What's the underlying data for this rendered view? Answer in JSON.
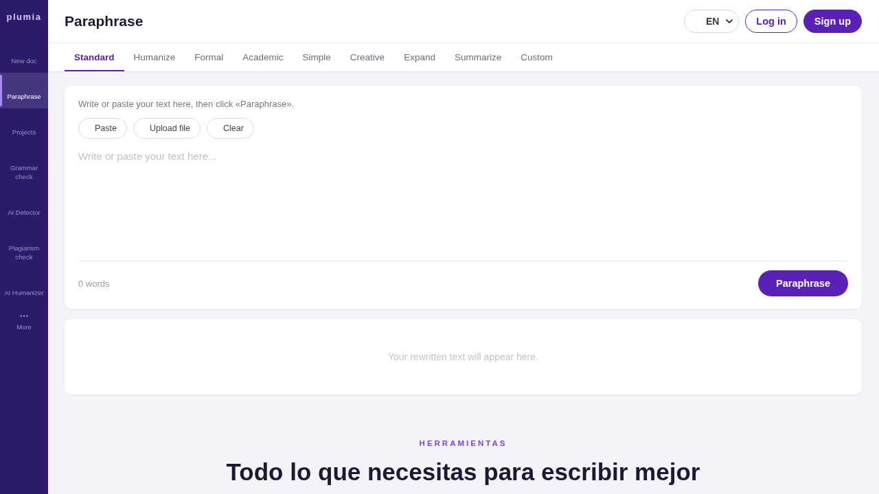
{
  "sidebar": {
    "logo": "plumia",
    "items": [
      {
        "label": "New doc",
        "selected": false
      },
      {
        "label": "Paraphrase",
        "selected": true
      },
      {
        "label": "Projects",
        "selected": false
      },
      {
        "label": "Grammar check",
        "selected": false
      },
      {
        "label": "AI Detector",
        "selected": false
      },
      {
        "label": "Plagiarism check",
        "selected": false
      },
      {
        "label": "AI Humanizer",
        "selected": false
      }
    ],
    "more": {
      "label": "More"
    }
  },
  "header": {
    "title": "Paraphrase",
    "language": "EN",
    "buttons": [
      {
        "label": "Log in",
        "kind": "outline"
      },
      {
        "label": "Sign up",
        "kind": "primary"
      }
    ]
  },
  "tabs": [
    {
      "label": "Standard",
      "selected": true
    },
    {
      "label": "Humanize",
      "selected": false
    },
    {
      "label": "Formal",
      "selected": false
    },
    {
      "label": "Academic",
      "selected": false
    },
    {
      "label": "Simple",
      "selected": false
    },
    {
      "label": "Creative",
      "selected": false
    },
    {
      "label": "Expand",
      "selected": false
    },
    {
      "label": "Summarize",
      "selected": false
    },
    {
      "label": "Custom",
      "selected": false
    }
  ],
  "editor": {
    "hint": "Write or paste your text here, then click «Paraphrase».",
    "actions": [
      "Paste",
      "Upload file",
      "Clear"
    ],
    "placeholder": "Write or paste your text here...",
    "word_count": "0 words",
    "submit": "Paraphrase"
  },
  "output": {
    "empty_message": "Your rewritten text will appear here."
  },
  "section": {
    "eyebrow": "HERRAMIENTAS",
    "heading": "Todo lo que necesitas para escribir mejor"
  }
}
